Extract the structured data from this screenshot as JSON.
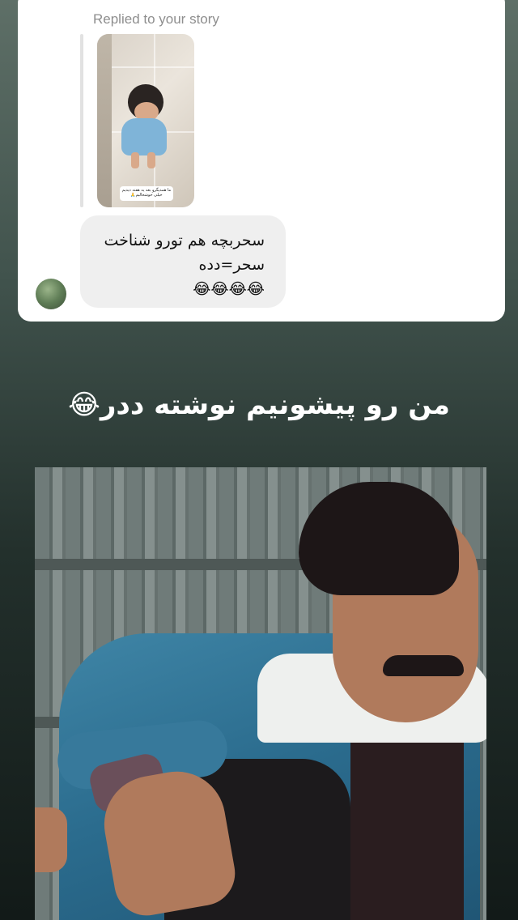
{
  "reply": {
    "label": "Replied to your story",
    "story_sticker_text": "ما همدیگرو بعد یه هفته دیدیم خیلی خوشحالیم🙏"
  },
  "message": {
    "lines": [
      "سحربچه هم تورو شناخت",
      "سحر=دده",
      "😂😂😂😂"
    ]
  },
  "headline": "من رو پیشونیم نوشته ددر😂",
  "colors": {
    "card": "#ffffff",
    "bubble": "#efefef",
    "label_gray": "#8e8e8e",
    "headline": "#ffffff"
  },
  "icons": {
    "avatar": "sender-avatar"
  }
}
